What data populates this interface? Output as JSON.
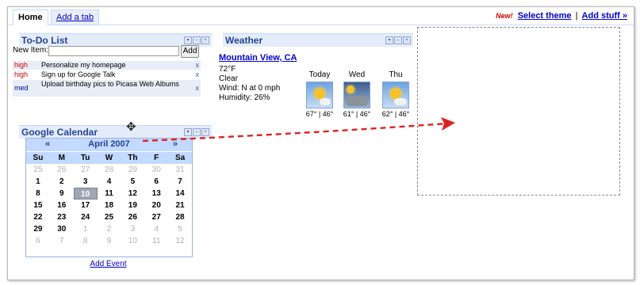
{
  "tabs": {
    "home": "Home",
    "add_tab": "Add a tab"
  },
  "top_right": {
    "new_badge": "New!",
    "select_theme": "Select theme",
    "separator": "|",
    "add_stuff": "Add stuff »"
  },
  "todo": {
    "title": "To-Do List",
    "new_item_label": "New Item:",
    "new_item_value": "",
    "add_button": "Add",
    "items": [
      {
        "priority": "high",
        "text": "Personalize my homepage",
        "remove": "x"
      },
      {
        "priority": "high",
        "text": "Sign up for Google Talk",
        "remove": "x"
      },
      {
        "priority": "med",
        "text": "Upload birthday pics to Picasa Web Albums",
        "remove": "x"
      }
    ]
  },
  "calendar": {
    "title": "Google Calendar",
    "prev": "«",
    "next": "»",
    "month": "April 2007",
    "weekdays": [
      "Su",
      "M",
      "Tu",
      "W",
      "Th",
      "F",
      "Sa"
    ],
    "weeks": [
      [
        "25",
        "26",
        "27",
        "28",
        "29",
        "30",
        "31"
      ],
      [
        "1",
        "2",
        "3",
        "4",
        "5",
        "6",
        "7"
      ],
      [
        "8",
        "9",
        "10",
        "11",
        "12",
        "13",
        "14"
      ],
      [
        "15",
        "16",
        "17",
        "18",
        "19",
        "20",
        "21"
      ],
      [
        "22",
        "23",
        "24",
        "25",
        "26",
        "27",
        "28"
      ],
      [
        "29",
        "30",
        "1",
        "2",
        "3",
        "4",
        "5"
      ],
      [
        "6",
        "7",
        "8",
        "9",
        "10",
        "11",
        "12"
      ]
    ],
    "today": "10",
    "add_event": "Add Event"
  },
  "weather": {
    "title": "Weather",
    "city": "Mountain View, CA",
    "temp": "72°F",
    "condition": "Clear",
    "wind": "Wind: N at 0 mph",
    "humidity": "Humidity: 26%",
    "forecast": [
      {
        "day": "Today",
        "icon": "sunny-icon",
        "temps": "67° | 46°"
      },
      {
        "day": "Wed",
        "icon": "cloudy-icon",
        "temps": "61° | 46°"
      },
      {
        "day": "Thu",
        "icon": "partly-cloudy-icon",
        "temps": "62° | 46°"
      }
    ]
  },
  "gadget_controls": [
    "▾",
    "–",
    "×"
  ],
  "move_cursor": "✥",
  "colors": {
    "gadget_header": "#e5ecf9",
    "title_text": "#224499",
    "link": "#0000cc",
    "priority_high": "#cc0000",
    "arrow": "#dd2222"
  }
}
